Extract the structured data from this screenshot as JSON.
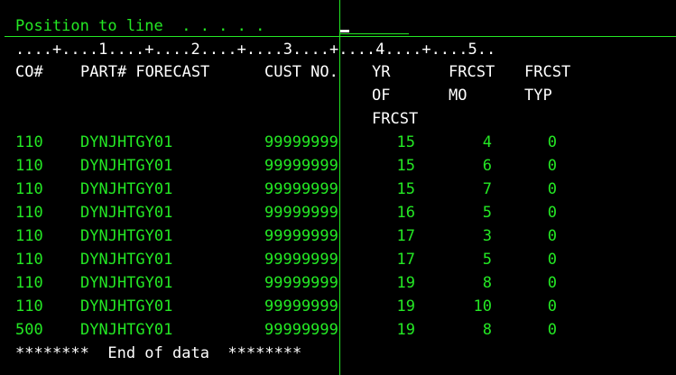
{
  "prompt": {
    "label": "Position to line  . . . . .",
    "value": ""
  },
  "ruler": "....+....1....+....2....+....3....+....4....+....5..",
  "headers": {
    "co": "CO#",
    "part_forecast": "PART# FORECAST",
    "cust": "CUST NO.",
    "yr": [
      "YR",
      "OF",
      "FRCST"
    ],
    "mo": [
      "FRCST",
      "MO"
    ],
    "typ": [
      "FRCST",
      "TYP"
    ]
  },
  "rows": [
    {
      "co": "110",
      "part": "DYNJHTGY01",
      "cust": "99999999",
      "yr": "15",
      "mo": "4",
      "typ": "0"
    },
    {
      "co": "110",
      "part": "DYNJHTGY01",
      "cust": "99999999",
      "yr": "15",
      "mo": "6",
      "typ": "0"
    },
    {
      "co": "110",
      "part": "DYNJHTGY01",
      "cust": "99999999",
      "yr": "15",
      "mo": "7",
      "typ": "0"
    },
    {
      "co": "110",
      "part": "DYNJHTGY01",
      "cust": "99999999",
      "yr": "16",
      "mo": "5",
      "typ": "0"
    },
    {
      "co": "110",
      "part": "DYNJHTGY01",
      "cust": "99999999",
      "yr": "17",
      "mo": "3",
      "typ": "0"
    },
    {
      "co": "110",
      "part": "DYNJHTGY01",
      "cust": "99999999",
      "yr": "17",
      "mo": "5",
      "typ": "0"
    },
    {
      "co": "110",
      "part": "DYNJHTGY01",
      "cust": "99999999",
      "yr": "19",
      "mo": "8",
      "typ": "0"
    },
    {
      "co": "110",
      "part": "DYNJHTGY01",
      "cust": "99999999",
      "yr": "19",
      "mo": "10",
      "typ": "0"
    },
    {
      "co": "500",
      "part": "DYNJHTGY01",
      "cust": "99999999",
      "yr": "19",
      "mo": "8",
      "typ": "0"
    }
  ],
  "footer": "********  End of data  ********",
  "colors": {
    "background": "#000000",
    "green": "#24e824",
    "white": "#ffffff"
  }
}
